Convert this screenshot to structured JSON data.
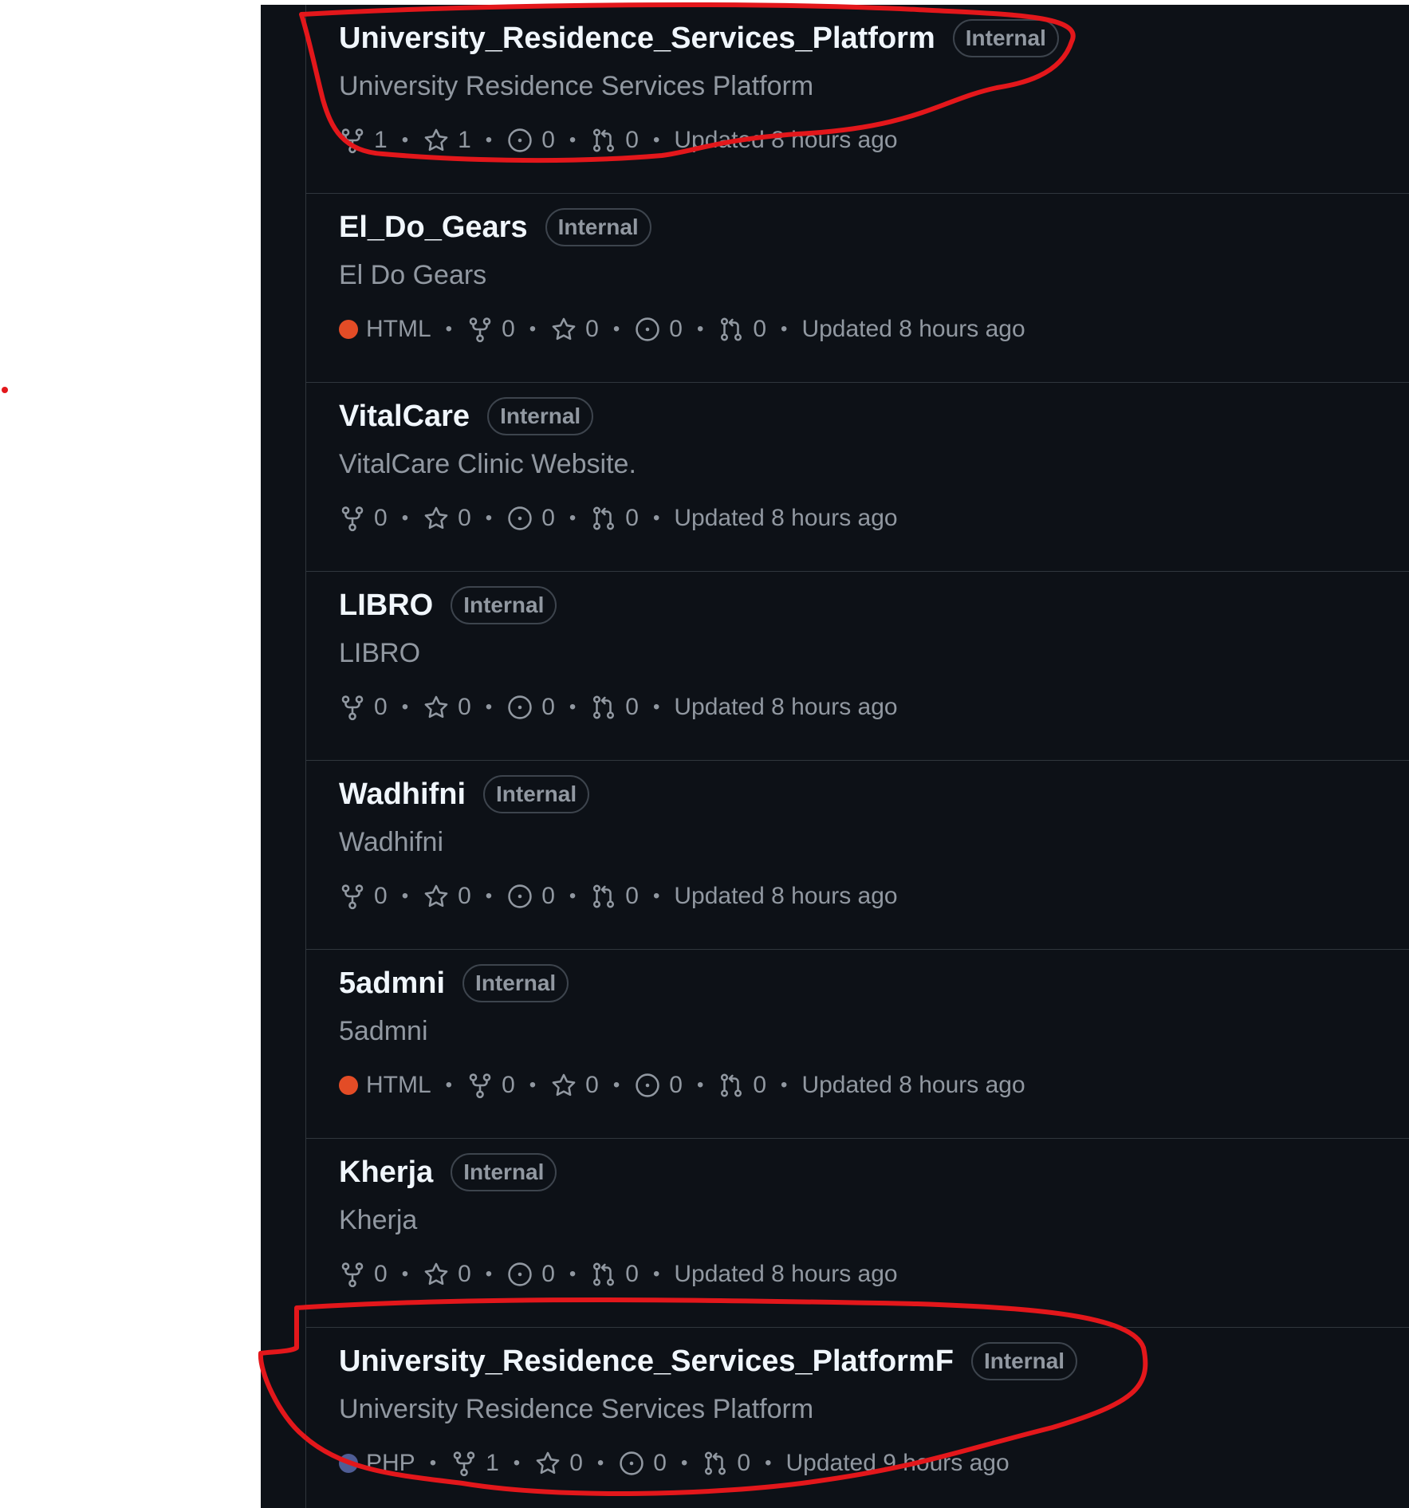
{
  "repos": [
    {
      "name": "University_Residence_Services_Platform",
      "visibility": "Internal",
      "description": "University Residence Services Platform",
      "language": null,
      "language_color": null,
      "forks": "1",
      "stars": "1",
      "issues": "0",
      "pulls": "0",
      "updated": "Updated 8 hours ago"
    },
    {
      "name": "El_Do_Gears",
      "visibility": "Internal",
      "description": "El Do Gears",
      "language": "HTML",
      "language_color": "#e34c26",
      "forks": "0",
      "stars": "0",
      "issues": "0",
      "pulls": "0",
      "updated": "Updated 8 hours ago"
    },
    {
      "name": "VitalCare",
      "visibility": "Internal",
      "description": "VitalCare Clinic Website.",
      "language": null,
      "language_color": null,
      "forks": "0",
      "stars": "0",
      "issues": "0",
      "pulls": "0",
      "updated": "Updated 8 hours ago"
    },
    {
      "name": "LIBRO",
      "visibility": "Internal",
      "description": "LIBRO",
      "language": null,
      "language_color": null,
      "forks": "0",
      "stars": "0",
      "issues": "0",
      "pulls": "0",
      "updated": "Updated 8 hours ago"
    },
    {
      "name": "Wadhifni",
      "visibility": "Internal",
      "description": "Wadhifni",
      "language": null,
      "language_color": null,
      "forks": "0",
      "stars": "0",
      "issues": "0",
      "pulls": "0",
      "updated": "Updated 8 hours ago"
    },
    {
      "name": "5admni",
      "visibility": "Internal",
      "description": "5admni",
      "language": "HTML",
      "language_color": "#e34c26",
      "forks": "0",
      "stars": "0",
      "issues": "0",
      "pulls": "0",
      "updated": "Updated 8 hours ago"
    },
    {
      "name": "Kherja",
      "visibility": "Internal",
      "description": "Kherja",
      "language": null,
      "language_color": null,
      "forks": "0",
      "stars": "0",
      "issues": "0",
      "pulls": "0",
      "updated": "Updated 8 hours ago"
    },
    {
      "name": "University_Residence_Services_PlatformF",
      "visibility": "Internal",
      "description": "University Residence Services Platform",
      "language": "PHP",
      "language_color": "#4F5D95",
      "forks": "1",
      "stars": "0",
      "issues": "0",
      "pulls": "0",
      "updated": "Updated 9 hours ago"
    }
  ],
  "icons": {
    "fork": "repo-forked-icon",
    "star": "star-icon",
    "issue": "issue-opened-icon",
    "pull": "git-pull-request-icon"
  },
  "annotation_color": "#e3171b"
}
